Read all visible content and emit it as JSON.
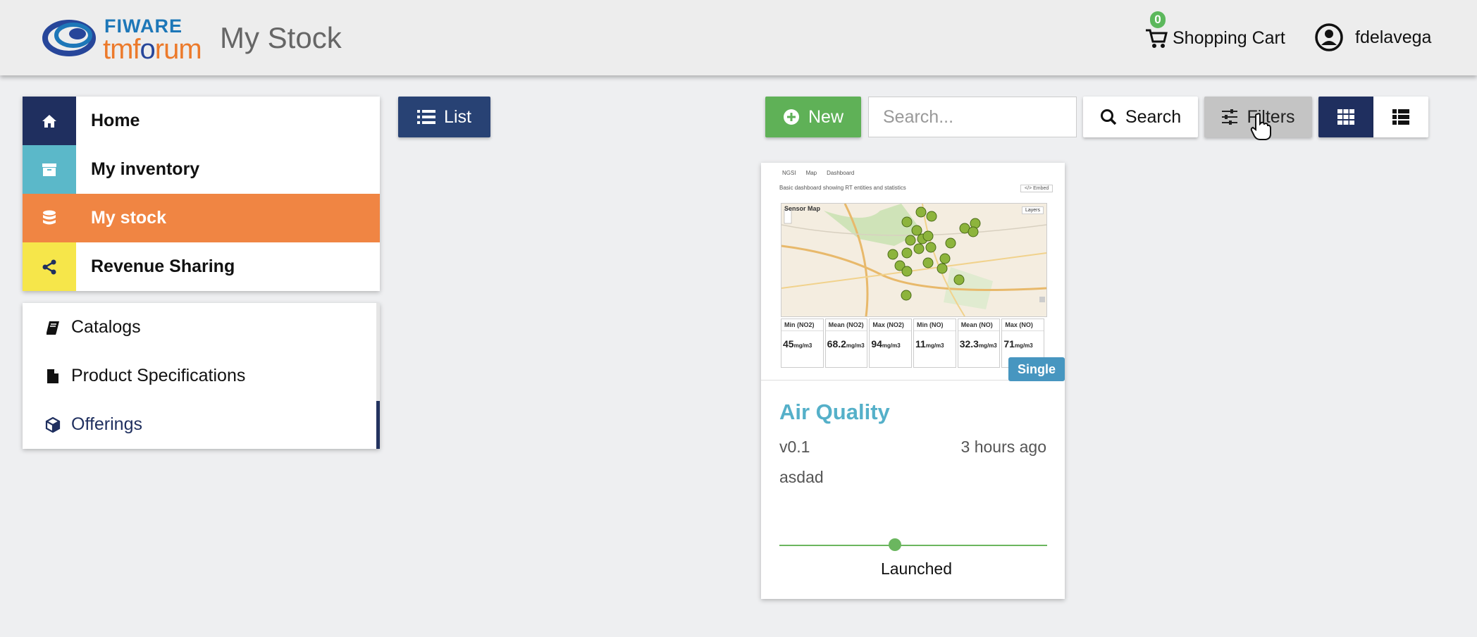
{
  "header": {
    "logo_top": "FIWARE",
    "logo_bottom_a": "tmf",
    "logo_bottom_b": "o",
    "logo_bottom_c": "rum",
    "title": "My Stock",
    "cart_label": "Shopping Cart",
    "cart_count": "0",
    "username": "fdelavega"
  },
  "nav": {
    "items": [
      {
        "label": "Home",
        "icon": "home-icon",
        "color": "#1f2f5f"
      },
      {
        "label": "My inventory",
        "icon": "archive-icon",
        "color": "#5bb8c9"
      },
      {
        "label": "My stock",
        "icon": "database-icon",
        "color": "#f08543",
        "active": true
      },
      {
        "label": "Revenue Sharing",
        "icon": "share-icon",
        "color": "#f6e64a"
      }
    ]
  },
  "subnav": {
    "items": [
      {
        "label": "Catalogs",
        "icon": "book-icon"
      },
      {
        "label": "Product Specifications",
        "icon": "file-icon"
      },
      {
        "label": "Offerings",
        "icon": "cube-icon",
        "selected": true
      }
    ]
  },
  "toolbar": {
    "list_label": "List",
    "new_label": "New",
    "search_placeholder": "Search...",
    "search_label": "Search",
    "filters_label": "Filters"
  },
  "card": {
    "title": "Air Quality",
    "version": "v0.1",
    "time": "3 hours ago",
    "description": "asdad",
    "status": "Launched",
    "badge": "Single",
    "thumbnail": {
      "tabs": [
        "NGSI",
        "Map",
        "Dashboard"
      ],
      "caption": "Basic dashboard showing RT entities and statistics",
      "embed": "</> Embed",
      "map_title": "Sensor Map",
      "layers": "Layers",
      "stats": [
        {
          "label": "Min (NO2)",
          "value": "45",
          "unit": "mg/m3"
        },
        {
          "label": "Mean (NO2)",
          "value": "68.2",
          "unit": "mg/m3"
        },
        {
          "label": "Max (NO2)",
          "value": "94",
          "unit": "mg/m3"
        },
        {
          "label": "Min (NO)",
          "value": "11",
          "unit": "mg/m3"
        },
        {
          "label": "Mean (NO)",
          "value": "32.3",
          "unit": "mg/m3"
        },
        {
          "label": "Max (NO)",
          "value": "71",
          "unit": "mg/m3"
        }
      ]
    }
  }
}
